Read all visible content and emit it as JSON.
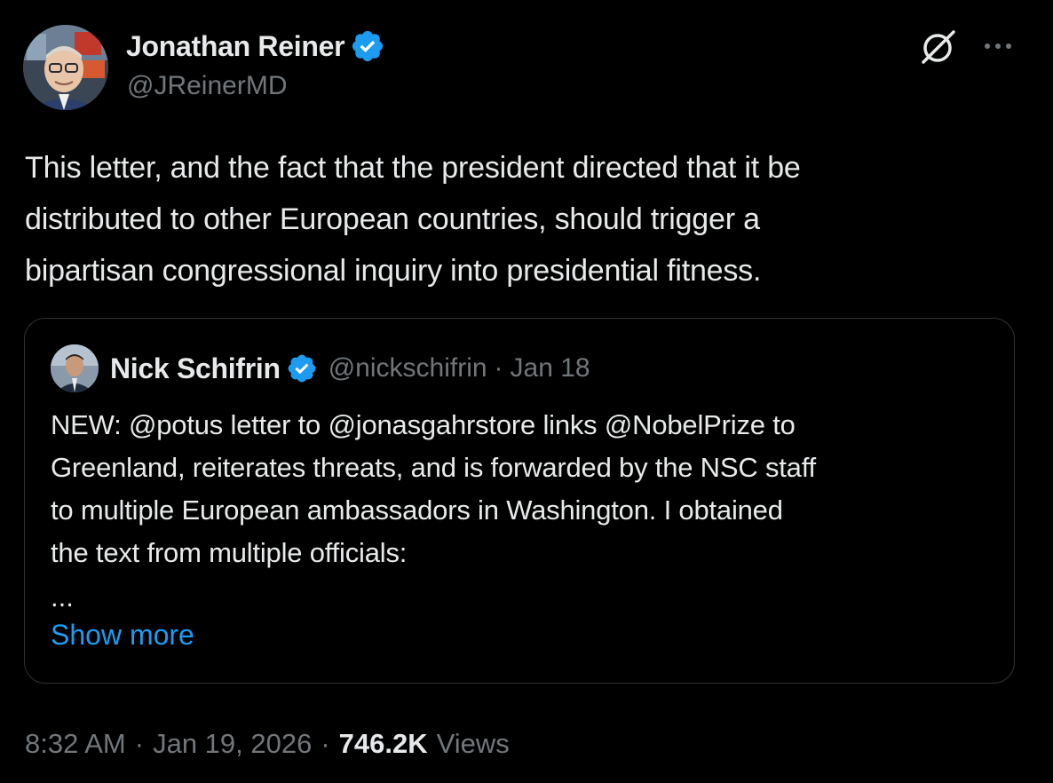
{
  "author": {
    "display_name": "Jonathan Reiner",
    "handle": "@JReinerMD",
    "verified": true
  },
  "tweet": {
    "text_lines": [
      "This letter, and the fact that the president directed that it be",
      "distributed to other European countries, should trigger a",
      "bipartisan congressional inquiry into presidential fitness."
    ],
    "time": "8:32 AM",
    "date": "Jan 19, 2026",
    "views_count": "746.2K",
    "views_label": "Views"
  },
  "quoted": {
    "display_name": "Nick Schifrin",
    "handle": "@nickschifrin",
    "separator": "·",
    "date": "Jan 18",
    "verified": true,
    "text_lines": [
      "NEW: @potus letter to @jonasgahrstore links @NobelPrize to",
      "Greenland, reiterates threats, and is forwarded by the NSC staff",
      "to multiple European ambassadors in Washington. I obtained",
      "the text from multiple officials:"
    ],
    "ellipsis": "...",
    "show_more_label": "Show more"
  },
  "meta": {
    "separator": "·"
  },
  "colors": {
    "background": "#000000",
    "text_primary": "#e7e9ea",
    "text_secondary": "#71767b",
    "link": "#1d9bf0",
    "verified_badge": "#1d9bf0",
    "border": "#2f3336"
  },
  "icons": {
    "verified": "verified-badge-icon",
    "grok": "grok-icon",
    "more": "more-options-icon"
  }
}
